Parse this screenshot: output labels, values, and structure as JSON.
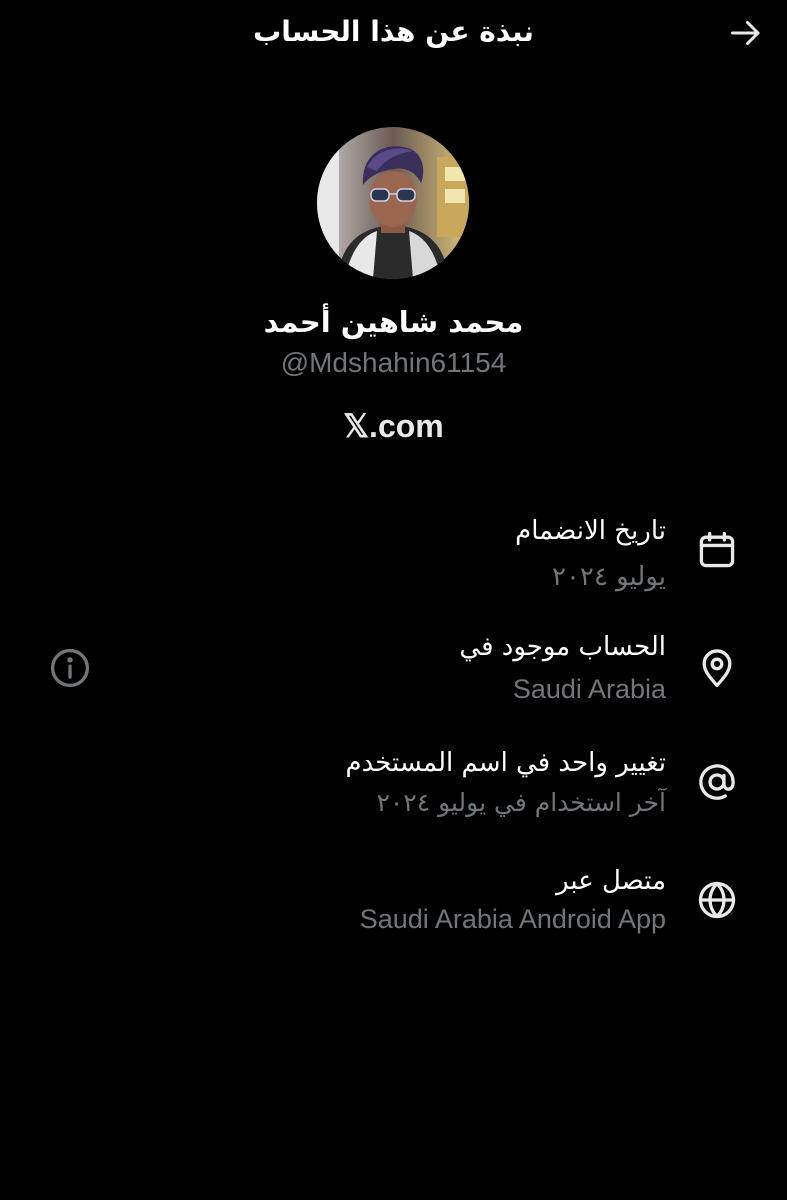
{
  "header": {
    "title": "نبذة عن هذا الحساب",
    "back_icon": "arrow-right-icon"
  },
  "profile": {
    "display_name": "محمد شاهين أحمد",
    "handle": "@Mdshahin61154",
    "site": "𝕏.com"
  },
  "details": [
    {
      "title": "تاريخ الانضمام",
      "value": "يوليو ٢٠٢٤",
      "icon": "calendar-icon"
    },
    {
      "title": "الحساب موجود في",
      "value": "Saudi Arabia",
      "icon": "location-pin-icon",
      "info_icon": "info-icon"
    },
    {
      "title": "تغيير واحد في اسم المستخدم",
      "value": "آخر استخدام في يوليو ٢٠٢٤",
      "icon": "at-sign-icon"
    },
    {
      "title": "متصل عبر",
      "value": "Saudi Arabia Android App",
      "icon": "globe-icon"
    }
  ],
  "colors": {
    "background": "#000000",
    "primary_text": "#e7e9ea",
    "secondary_text": "#71767b"
  }
}
